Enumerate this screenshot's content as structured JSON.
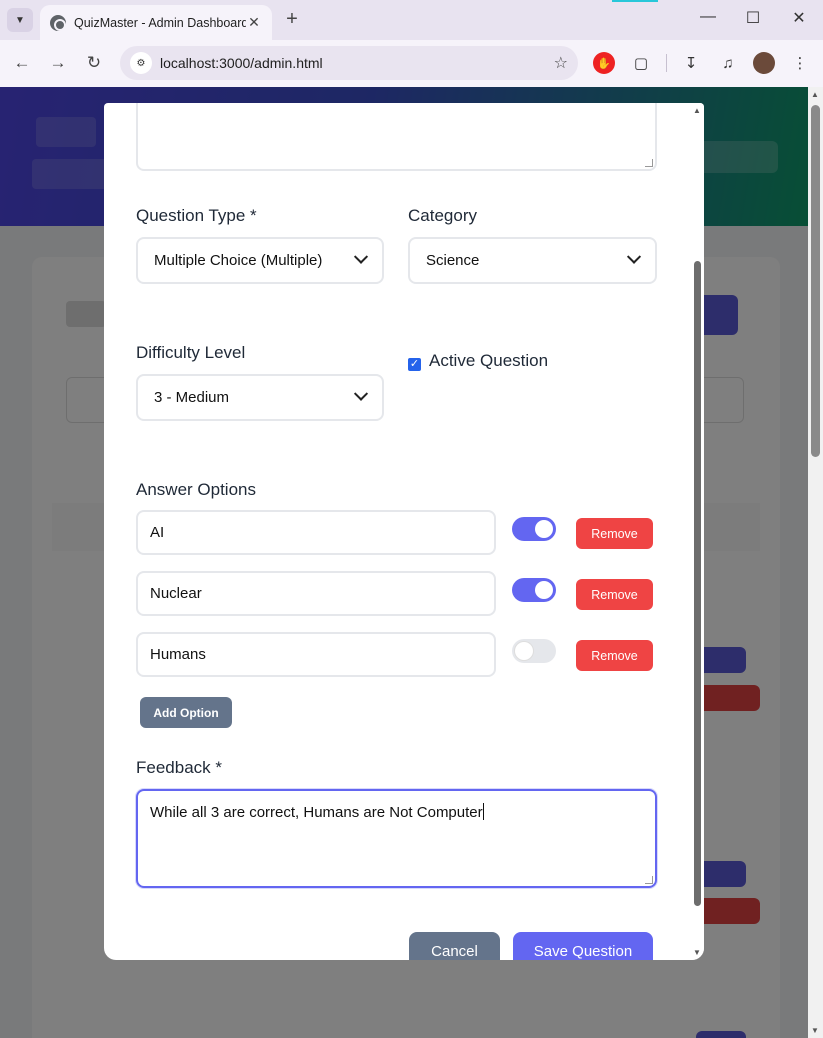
{
  "browser": {
    "tab_title": "QuizMaster - Admin Dashboard",
    "url": "localhost:3000/admin.html"
  },
  "modal": {
    "question_type_label": "Question Type *",
    "question_type_value": "Multiple Choice (Multiple)",
    "category_label": "Category",
    "category_value": "Science",
    "difficulty_label": "Difficulty Level",
    "difficulty_value": "3 - Medium",
    "active_label": "Active Question",
    "active_checked": true,
    "answer_options_label": "Answer Options",
    "options": [
      {
        "text": "AI",
        "correct": true,
        "remove_label": "Remove"
      },
      {
        "text": "Nuclear",
        "correct": true,
        "remove_label": "Remove"
      },
      {
        "text": "Humans",
        "correct": false,
        "remove_label": "Remove"
      }
    ],
    "add_option_label": "Add Option",
    "feedback_label": "Feedback *",
    "feedback_value": "While all 3 are correct, Humans are Not Computer",
    "cancel_label": "Cancel",
    "save_label": "Save Question"
  },
  "colors": {
    "primary": "#6366f1",
    "danger": "#ef4444",
    "neutral_button": "#64748b"
  }
}
